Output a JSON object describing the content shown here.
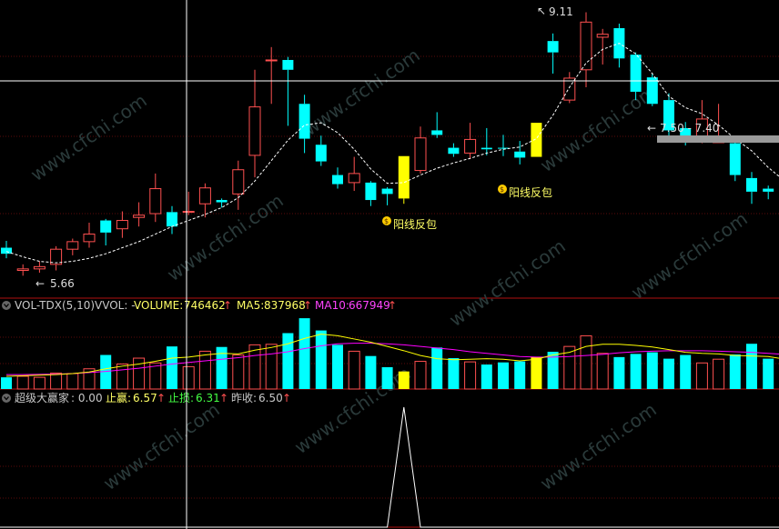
{
  "watermark": "www.cfchi.com",
  "main_panel": {
    "high_label": "9.11",
    "low_label": "5.66",
    "range_label": "7.50 - 7.40",
    "signal_label": "阳线反包"
  },
  "volume_panel": {
    "title": "VOL-TDX(5,10)",
    "vvol": "VVOL: -",
    "volume_label": "VOLUME:",
    "volume_value": "746462",
    "ma5_label": "MA5:",
    "ma5_value": "837968",
    "ma10_label": "MA10:",
    "ma10_value": "667949"
  },
  "indicator_panel": {
    "title": "超级大赢家",
    "value": ": 0.00",
    "stop_profit_label": "止赢:",
    "stop_profit_value": "6.57",
    "stop_loss_label": "止损:",
    "stop_loss_value": "6.31",
    "prev_close_label": "昨收:",
    "prev_close_value": "6.50"
  },
  "colors": {
    "up": "#ff5050",
    "down": "#00ffff",
    "signal": "#ffff00",
    "ma5": "#ffff00",
    "ma10": "#ff00ff",
    "grid": "#b01010",
    "crosshair": "#ffffff"
  },
  "chart_data": {
    "type": "candlestick",
    "price_ylim": [
      5.55,
      9.2
    ],
    "candles": [
      {
        "o": 6.0,
        "h": 6.09,
        "l": 5.86,
        "c": 5.92,
        "v": 220000
      },
      {
        "o": 5.7,
        "h": 5.78,
        "l": 5.63,
        "c": 5.72,
        "v": 240000
      },
      {
        "o": 5.72,
        "h": 5.82,
        "l": 5.67,
        "c": 5.75,
        "v": 220000
      },
      {
        "o": 5.78,
        "h": 6.02,
        "l": 5.7,
        "c": 5.98,
        "v": 300000
      },
      {
        "o": 5.98,
        "h": 6.12,
        "l": 5.9,
        "c": 6.08,
        "v": 290000
      },
      {
        "o": 6.08,
        "h": 6.33,
        "l": 6.0,
        "c": 6.18,
        "v": 380000
      },
      {
        "o": 6.36,
        "h": 6.38,
        "l": 6.03,
        "c": 6.2,
        "v": 640000
      },
      {
        "o": 6.25,
        "h": 6.48,
        "l": 6.13,
        "c": 6.36,
        "v": 470000
      },
      {
        "o": 6.4,
        "h": 6.6,
        "l": 6.28,
        "c": 6.43,
        "v": 580000
      },
      {
        "o": 6.45,
        "h": 6.98,
        "l": 6.34,
        "c": 6.78,
        "v": 490000
      },
      {
        "o": 6.47,
        "h": 6.55,
        "l": 6.18,
        "c": 6.28,
        "v": 800000
      },
      {
        "o": 6.48,
        "h": 6.74,
        "l": 6.43,
        "c": 6.48,
        "v": 420000
      },
      {
        "o": 6.58,
        "h": 6.85,
        "l": 6.4,
        "c": 6.79,
        "v": 710000
      },
      {
        "o": 6.63,
        "h": 6.65,
        "l": 6.53,
        "c": 6.6,
        "v": 790000
      },
      {
        "o": 6.71,
        "h": 7.15,
        "l": 6.5,
        "c": 7.03,
        "v": 640000
      },
      {
        "o": 7.22,
        "h": 8.35,
        "l": 6.93,
        "c": 7.86,
        "v": 830000
      },
      {
        "o": 8.48,
        "h": 8.65,
        "l": 7.9,
        "c": 8.48,
        "v": 840000
      },
      {
        "o": 8.48,
        "h": 8.52,
        "l": 7.61,
        "c": 8.35,
        "v": 1050000
      },
      {
        "o": 7.9,
        "h": 8.02,
        "l": 7.25,
        "c": 7.44,
        "v": 1330000
      },
      {
        "o": 7.36,
        "h": 7.48,
        "l": 7.08,
        "c": 7.14,
        "v": 1100000
      },
      {
        "o": 6.96,
        "h": 7.06,
        "l": 6.78,
        "c": 6.84,
        "v": 830000
      },
      {
        "o": 6.86,
        "h": 7.2,
        "l": 6.75,
        "c": 6.98,
        "v": 710000
      },
      {
        "o": 6.86,
        "h": 6.88,
        "l": 6.55,
        "c": 6.63,
        "v": 620000
      },
      {
        "o": 6.78,
        "h": 6.8,
        "l": 6.56,
        "c": 6.71,
        "v": 410000
      },
      {
        "o": 6.65,
        "h": 7.21,
        "l": 6.58,
        "c": 7.21,
        "v": 330000,
        "signal": true
      },
      {
        "o": 7.02,
        "h": 7.6,
        "l": 6.98,
        "c": 7.45,
        "v": 520000
      },
      {
        "o": 7.55,
        "h": 7.79,
        "l": 7.45,
        "c": 7.49,
        "v": 780000
      },
      {
        "o": 7.32,
        "h": 7.38,
        "l": 7.2,
        "c": 7.24,
        "v": 580000
      },
      {
        "o": 7.25,
        "h": 7.65,
        "l": 7.17,
        "c": 7.43,
        "v": 510000
      },
      {
        "o": 7.32,
        "h": 7.58,
        "l": 7.22,
        "c": 7.3,
        "v": 460000
      },
      {
        "o": 7.32,
        "h": 7.49,
        "l": 7.21,
        "c": 7.31,
        "v": 500000
      },
      {
        "o": 7.27,
        "h": 7.41,
        "l": 7.1,
        "c": 7.19,
        "v": 520000
      },
      {
        "o": 7.2,
        "h": 7.65,
        "l": 7.2,
        "c": 7.65,
        "v": 600000,
        "signal": true
      },
      {
        "o": 8.73,
        "h": 8.83,
        "l": 8.3,
        "c": 8.58,
        "v": 700000
      },
      {
        "o": 7.95,
        "h": 8.32,
        "l": 7.91,
        "c": 8.24,
        "v": 800000
      },
      {
        "o": 8.35,
        "h": 9.11,
        "l": 8.12,
        "c": 8.98,
        "v": 1000000
      },
      {
        "o": 8.78,
        "h": 8.89,
        "l": 8.42,
        "c": 8.82,
        "v": 670000
      },
      {
        "o": 8.9,
        "h": 8.96,
        "l": 8.38,
        "c": 8.5,
        "v": 600000
      },
      {
        "o": 8.55,
        "h": 8.58,
        "l": 7.95,
        "c": 8.06,
        "v": 660000
      },
      {
        "o": 8.25,
        "h": 8.3,
        "l": 7.87,
        "c": 7.9,
        "v": 690000
      },
      {
        "o": 7.95,
        "h": 8.04,
        "l": 7.48,
        "c": 7.55,
        "v": 570000
      },
      {
        "o": 7.58,
        "h": 7.66,
        "l": 7.35,
        "c": 7.4,
        "v": 640000
      },
      {
        "o": 7.41,
        "h": 7.95,
        "l": 7.38,
        "c": 7.7,
        "v": 490000
      },
      {
        "o": 7.4,
        "h": 7.9,
        "l": 7.39,
        "c": 7.4,
        "v": 560000
      },
      {
        "o": 7.38,
        "h": 7.48,
        "l": 6.88,
        "c": 6.96,
        "v": 650000
      },
      {
        "o": 6.92,
        "h": 7.0,
        "l": 6.58,
        "c": 6.74,
        "v": 850000
      },
      {
        "o": 6.78,
        "h": 6.82,
        "l": 6.64,
        "c": 6.74,
        "v": 570000
      },
      {
        "o": 6.76,
        "h": 6.77,
        "l": 6.7,
        "c": 6.72,
        "v": 310000
      },
      {
        "o": 6.7,
        "h": 6.8,
        "l": 6.54,
        "c": 6.58,
        "v": 300000
      },
      {
        "o": 6.62,
        "h": 6.66,
        "l": 6.48,
        "c": 6.51,
        "v": 270000
      },
      {
        "o": 6.52,
        "h": 6.52,
        "l": 6.4,
        "c": 6.42,
        "v": 290000
      }
    ],
    "ma_price": [
      5.95,
      5.88,
      5.82,
      5.8,
      5.82,
      5.86,
      5.92,
      6.0,
      6.08,
      6.18,
      6.28,
      6.36,
      6.44,
      6.53,
      6.66,
      6.88,
      7.15,
      7.42,
      7.62,
      7.65,
      7.52,
      7.3,
      7.04,
      6.85,
      6.86,
      6.96,
      7.05,
      7.12,
      7.18,
      7.25,
      7.3,
      7.33,
      7.44,
      7.75,
      8.12,
      8.44,
      8.62,
      8.7,
      8.56,
      8.3,
      8.0,
      7.85,
      7.77,
      7.62,
      7.44,
      7.28,
      7.06,
      6.88,
      6.76,
      6.66,
      6.58
    ],
    "ma5_vol": [
      240000,
      250000,
      260000,
      270000,
      290000,
      320000,
      380000,
      430000,
      470000,
      520000,
      580000,
      600000,
      640000,
      670000,
      660000,
      730000,
      780000,
      850000,
      950000,
      1030000,
      1000000,
      940000,
      880000,
      800000,
      720000,
      630000,
      570000,
      550000,
      560000,
      570000,
      560000,
      530000,
      560000,
      640000,
      690000,
      800000,
      840000,
      840000,
      820000,
      790000,
      740000,
      690000,
      670000,
      660000,
      630000,
      620000,
      610000,
      560000,
      500000,
      420000,
      340000
    ],
    "ma10_vol": [
      270000,
      270000,
      275000,
      280000,
      290000,
      310000,
      330000,
      360000,
      390000,
      430000,
      470000,
      500000,
      530000,
      560000,
      590000,
      630000,
      660000,
      700000,
      760000,
      810000,
      850000,
      860000,
      860000,
      850000,
      830000,
      800000,
      770000,
      740000,
      700000,
      670000,
      640000,
      610000,
      600000,
      600000,
      610000,
      630000,
      650000,
      680000,
      700000,
      710000,
      720000,
      720000,
      720000,
      710000,
      700000,
      690000,
      670000,
      650000,
      620000,
      590000,
      560000
    ],
    "indicator": {
      "peak_index": 24,
      "peak_value": 1,
      "ylim": [
        0,
        1
      ]
    }
  }
}
